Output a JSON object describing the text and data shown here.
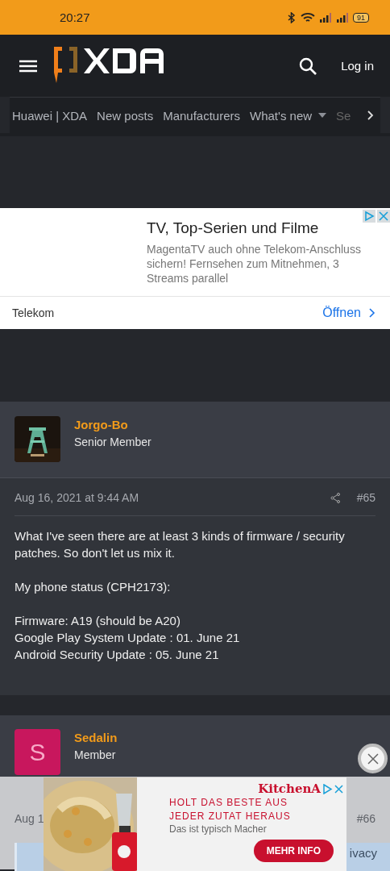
{
  "status_bar": {
    "time": "20:27",
    "battery": "91"
  },
  "header": {
    "login": "Log in"
  },
  "nav": {
    "items": [
      {
        "label": "Huawei | XDA",
        "dropdown": false
      },
      {
        "label": "New posts",
        "dropdown": false
      },
      {
        "label": "Manufacturers",
        "dropdown": false
      },
      {
        "label": "What's new",
        "dropdown": true
      },
      {
        "label": "Se",
        "dropdown": false
      }
    ]
  },
  "ad_top": {
    "title": "TV, Top-Serien und Filme",
    "text": "MagentaTV auch ohne Telekom-Anschluss sichern! Fernsehen zum Mitnehmen, 3 Streams parallel",
    "advertiser": "Telekom",
    "action": "Öffnen"
  },
  "posts": [
    {
      "author": "Jorgo-Bo",
      "role": "Senior Member",
      "date": "Aug 16, 2021 at 9:44 AM",
      "number": "#65",
      "paragraphs": [
        "What I've seen there are at least 3 kinds of firmware / security patches. So don't let us mix it.",
        "My phone status (CPH2173):",
        "Firmware: A19 (should be A20)\nGoogle Play System Update : 01. June 21\nAndroid Security Update : 05. June 21"
      ]
    },
    {
      "author": "Sedalin",
      "role": "Member",
      "avatar": {
        "kind": "letter",
        "letter": "S",
        "color": "#c8175d"
      },
      "date": "Aug 1",
      "number": "#66"
    }
  ],
  "cookie_fragment": "ivacy",
  "ad_bottom": {
    "brand": "KitchenA",
    "headline": "HOLT DAS BESTE AUS\nJEDER ZUTAT HERAUS",
    "tagline": "Das ist typisch Macher",
    "button": "MEHR INFO"
  }
}
